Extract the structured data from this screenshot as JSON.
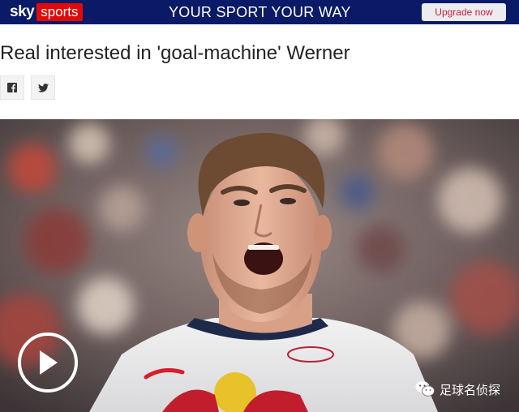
{
  "banner": {
    "logo_sky": "sky",
    "logo_sports": "sports",
    "tagline": "YOUR SPORT YOUR WAY",
    "upgrade_label": "Upgrade now",
    "bg_color": "#0a1a66",
    "brand_red": "#e10a0a"
  },
  "article": {
    "headline": "Real interested in 'goal-machine' Werner"
  },
  "share": {
    "facebook_icon": "facebook-icon",
    "twitter_icon": "twitter-icon"
  },
  "media": {
    "play_icon": "play-icon"
  },
  "watermark": {
    "text": "足球名侦探",
    "icon": "wechat-icon"
  }
}
